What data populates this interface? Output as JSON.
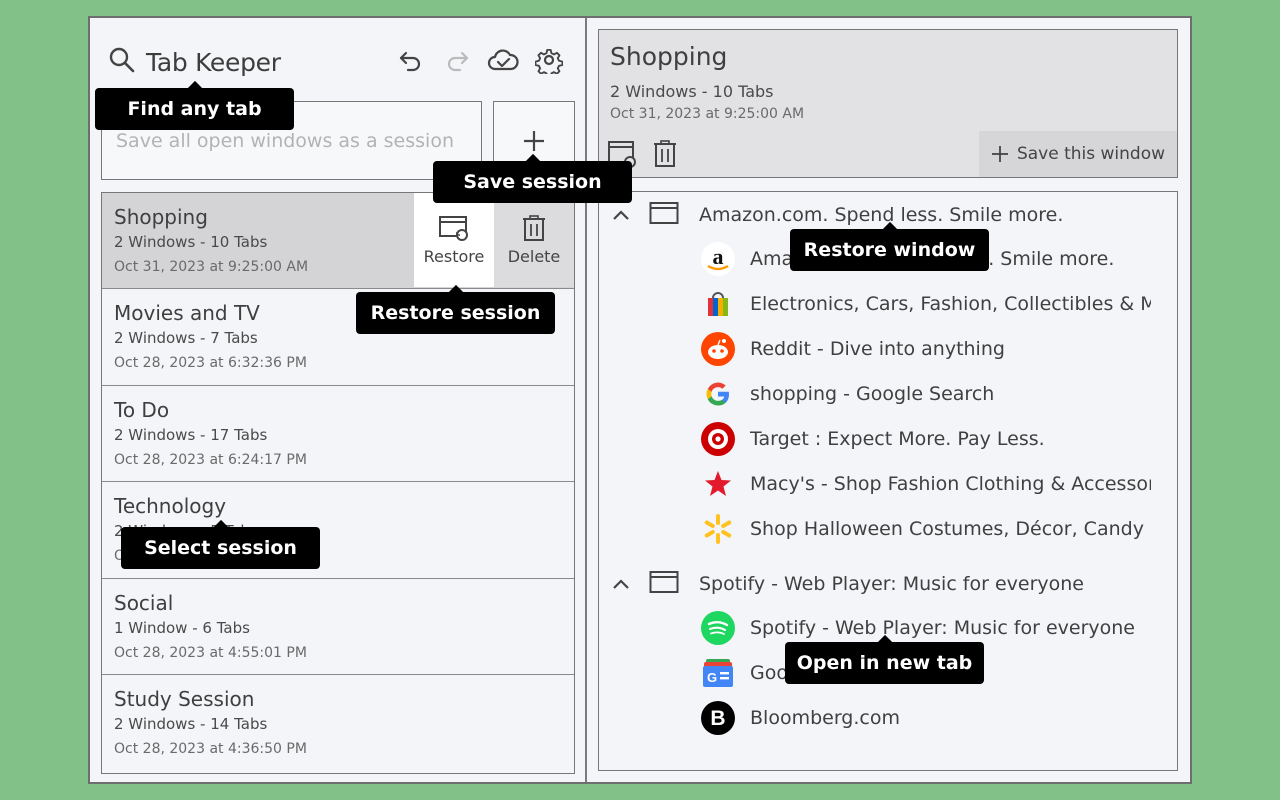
{
  "app": {
    "title": "Tab Keeper"
  },
  "save": {
    "placeholder": "Save all open windows as a session"
  },
  "sessions": [
    {
      "name": "Shopping",
      "meta": "2 Windows - 10 Tabs",
      "date": "Oct 31, 2023 at 9:25:00 AM"
    },
    {
      "name": "Movies and TV",
      "meta": "2 Windows - 7 Tabs",
      "date": "Oct 28, 2023 at 6:32:36 PM"
    },
    {
      "name": "To Do",
      "meta": "2 Windows - 17 Tabs",
      "date": "Oct 28, 2023 at 6:24:17 PM"
    },
    {
      "name": "Technology",
      "meta": "2 Windows - 5 Tabs",
      "date": "Oct 28, 2023 at 5:11:20 PM"
    },
    {
      "name": "Social",
      "meta": "1 Window - 6 Tabs",
      "date": "Oct 28, 2023 at 4:55:01 PM"
    },
    {
      "name": "Study Session",
      "meta": "2 Windows - 14 Tabs",
      "date": "Oct 28, 2023 at 4:36:50 PM"
    }
  ],
  "session_actions": {
    "restore": "Restore",
    "delete": "Delete"
  },
  "detail": {
    "name": "Shopping",
    "meta": "2 Windows - 10 Tabs",
    "date": "Oct 31, 2023 at 9:25:00 AM",
    "save_window": "Save this window"
  },
  "windows": [
    {
      "title": "Amazon.com. Spend less. Smile more.",
      "tabs": [
        {
          "title": "Amazon.com. Spend less. Smile more.",
          "icon": "amazon-icon",
          "color": "#ffffff"
        },
        {
          "title": "Electronics, Cars, Fashion, Collectibles & More | eBay",
          "icon": "ebay-icon",
          "color": "#ffffff"
        },
        {
          "title": "Reddit - Dive into anything",
          "icon": "reddit-icon",
          "color": "#ff4500"
        },
        {
          "title": "shopping - Google Search",
          "icon": "google-icon",
          "color": "#ffffff"
        },
        {
          "title": "Target : Expect More. Pay Less.",
          "icon": "target-icon",
          "color": "#cc0000"
        },
        {
          "title": "Macy's - Shop Fashion Clothing & Accessories",
          "icon": "macys-star-icon",
          "color": "#e21a2c"
        },
        {
          "title": "Shop Halloween Costumes, Décor, Candy & More",
          "icon": "walmart-spark-icon",
          "color": "#ffc220"
        }
      ]
    },
    {
      "title": "Spotify - Web Player: Music for everyone",
      "tabs": [
        {
          "title": "Spotify - Web Player: Music for everyone",
          "icon": "spotify-icon",
          "color": "#1ed760"
        },
        {
          "title": "Google News",
          "icon": "google-news-icon",
          "color": "#4285f4"
        },
        {
          "title": "Bloomberg.com",
          "icon": "bloomberg-icon",
          "color": "#000000"
        }
      ]
    }
  ],
  "tooltips": {
    "find": "Find any tab",
    "save_session": "Save session",
    "restore_session": "Restore session",
    "restore_window": "Restore window",
    "select_session": "Select session",
    "open_new_tab": "Open in new tab"
  }
}
